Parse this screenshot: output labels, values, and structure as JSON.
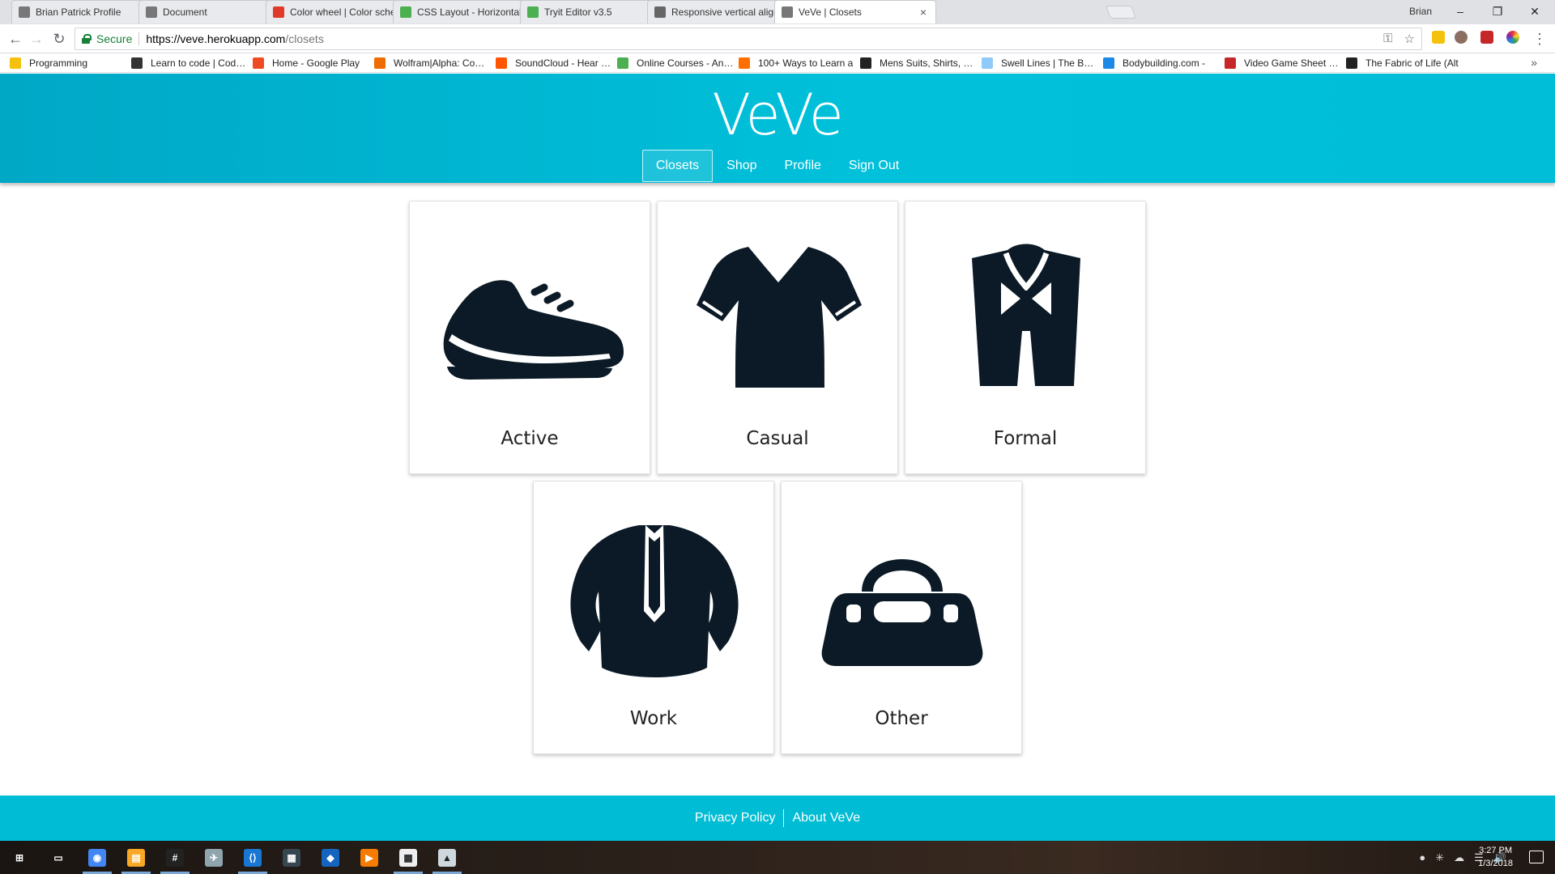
{
  "browser": {
    "tabs": [
      {
        "title": "Brian Patrick Profile",
        "favicon": "page-icon",
        "color": "#777777",
        "active": false
      },
      {
        "title": "Document",
        "favicon": "page-icon",
        "color": "#777777",
        "active": false
      },
      {
        "title": "Color wheel | Color schemes",
        "favicon": "adobe-icon",
        "color": "#e03a2a",
        "active": false
      },
      {
        "title": "CSS Layout - Horizontal & Vertical",
        "favicon": "w3-icon",
        "color": "#4caf50",
        "active": false
      },
      {
        "title": "Tryit Editor v3.5",
        "favicon": "w3-icon",
        "color": "#4caf50",
        "active": false
      },
      {
        "title": "Responsive vertical align",
        "favicon": "gear-icon",
        "color": "#666666",
        "active": false
      },
      {
        "title": "VeVe | Closets",
        "favicon": "page-icon",
        "color": "#777777",
        "active": true
      }
    ],
    "profile_name": "Brian",
    "window_controls": {
      "minimize": "–",
      "restore": "❐",
      "close": "✕"
    },
    "address": {
      "secure_label": "Secure",
      "url_scheme_host": "https://veve.herokuapp.com",
      "url_path": "/closets"
    },
    "bookmarks": [
      {
        "label": "Programming",
        "icon_color": "#f4c20d"
      },
      {
        "label": "Learn to code | Codecademy",
        "icon_color": "#333333"
      },
      {
        "label": "Home - Google Play",
        "icon_color": "#ef4b23"
      },
      {
        "label": "Wolfram|Alpha: Computational",
        "icon_color": "#ef6c00"
      },
      {
        "label": "SoundCloud - Hear the world",
        "icon_color": "#ff5500"
      },
      {
        "label": "Online Courses - Anytime",
        "icon_color": "#4caf50"
      },
      {
        "label": "100+ Ways to Learn a",
        "icon_color": "#ff6f00"
      },
      {
        "label": "Mens Suits, Shirts, Pants",
        "icon_color": "#222222"
      },
      {
        "label": "Swell Lines | The Body",
        "icon_color": "#90caf9"
      },
      {
        "label": "Bodybuilding.com - ",
        "icon_color": "#1e88e5"
      },
      {
        "label": "Video Game Sheet Music",
        "icon_color": "#c62828"
      },
      {
        "label": "The Fabric of Life (Alt",
        "icon_color": "#222222"
      }
    ]
  },
  "site": {
    "brand": "VeVe",
    "nav": [
      {
        "label": "Closets",
        "active": true
      },
      {
        "label": "Shop",
        "active": false
      },
      {
        "label": "Profile",
        "active": false
      },
      {
        "label": "Sign Out",
        "active": false
      }
    ],
    "closets": [
      {
        "label": "Active",
        "icon": "sneaker-icon"
      },
      {
        "label": "Casual",
        "icon": "tshirt-icon"
      },
      {
        "label": "Formal",
        "icon": "tuxedo-icon"
      },
      {
        "label": "Work",
        "icon": "blazer-icon"
      },
      {
        "label": "Other",
        "icon": "handbag-icon"
      }
    ],
    "footer": {
      "privacy": "Privacy Policy",
      "about": "About VeVe"
    },
    "colors": {
      "header": "#00bcd4",
      "icon": "#0b1a26",
      "footer": "#00bcd4"
    }
  },
  "taskbar": {
    "apps": [
      "windows-icon",
      "task-view-icon",
      "chrome-icon",
      "file-explorer-icon",
      "slack-icon",
      "app-icon",
      "vscode-icon",
      "ssms-icon",
      "sourcetree-icon",
      "plex-icon",
      "calculator-icon",
      "photos-icon"
    ],
    "time": "3:27 PM",
    "date": "1/3/2018"
  }
}
